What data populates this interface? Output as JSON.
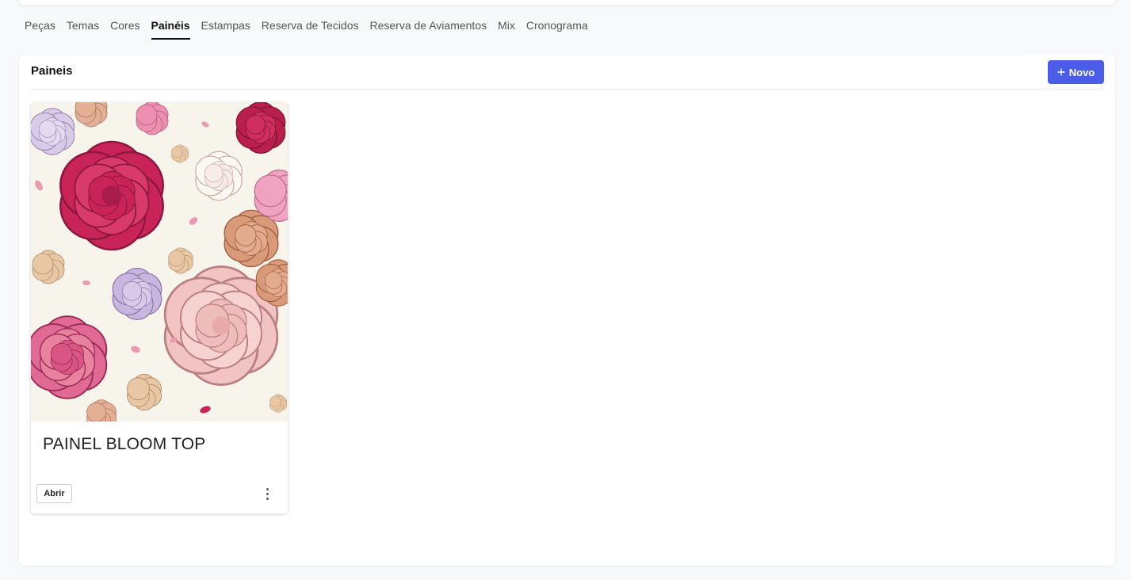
{
  "tabs": [
    {
      "label": "Peças",
      "active": false
    },
    {
      "label": "Temas",
      "active": false
    },
    {
      "label": "Cores",
      "active": false
    },
    {
      "label": "Painéis",
      "active": true
    },
    {
      "label": "Estampas",
      "active": false
    },
    {
      "label": "Reserva de Tecidos",
      "active": false
    },
    {
      "label": "Reserva de Aviamentos",
      "active": false
    },
    {
      "label": "Mix",
      "active": false
    },
    {
      "label": "Cronograma",
      "active": false
    }
  ],
  "panel": {
    "title": "Paineis",
    "new_button": {
      "icon": "plus-icon",
      "label": "Novo"
    }
  },
  "cards": [
    {
      "image": "floral-pattern-image",
      "title": "PAINEL BLOOM TOP",
      "open_label": "Abrir",
      "menu_icon": "more-vertical-icon"
    }
  ],
  "colors": {
    "accent": "#4a5ce8",
    "page_background": "#f8f9fa",
    "floral_background": "#f7f4ec",
    "crimson": "#c8245a",
    "pink": "#e06a94",
    "blush": "#f2c3c3",
    "peach": "#d99a7a",
    "lavender": "#c9b6de",
    "tan": "#e3c1a0"
  }
}
